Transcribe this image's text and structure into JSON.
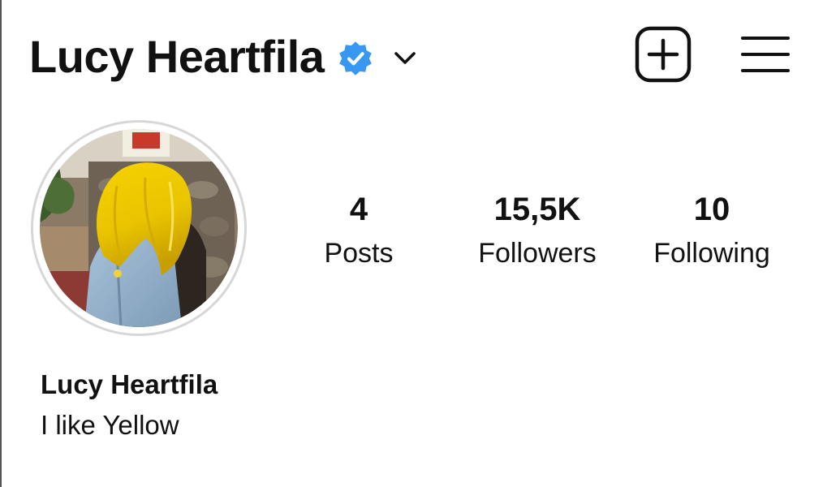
{
  "header": {
    "username": "Lucy Heartfila",
    "verified_color": "#3897f0"
  },
  "icons": {
    "verified": "verified-badge-icon",
    "switch_account": "chevron-down-icon",
    "new_post": "add-square-icon",
    "menu": "hamburger-menu-icon"
  },
  "stats": [
    {
      "value": "4",
      "label": "Posts"
    },
    {
      "value": "15,5K",
      "label": "Followers"
    },
    {
      "value": "10",
      "label": "Following"
    }
  ],
  "bio": {
    "name": "Lucy Heartfila",
    "text": "I like Yellow"
  }
}
